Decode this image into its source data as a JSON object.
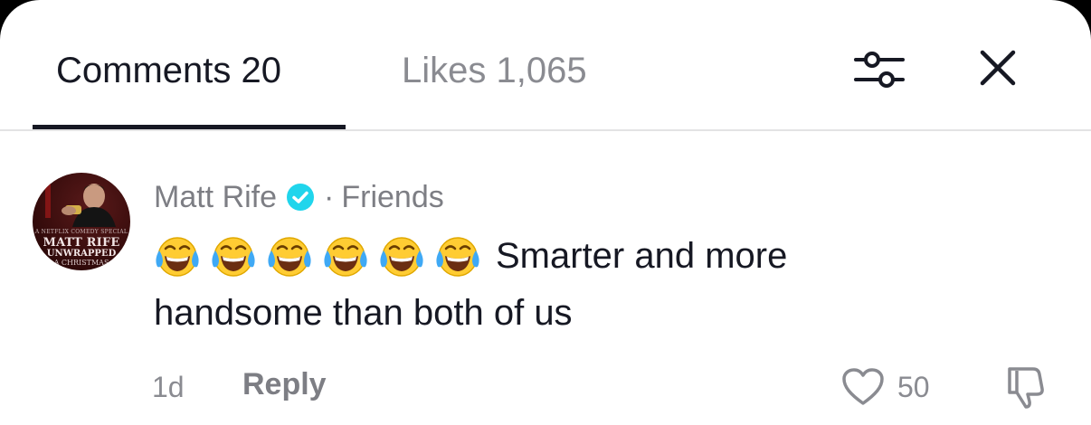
{
  "tabs": {
    "comments_label": "Comments 20",
    "likes_label": "Likes 1,065"
  },
  "icons": {
    "filter": "filter-sliders-icon",
    "close": "close-icon",
    "verified": "verified-badge-icon",
    "emoji": "face-with-tears-of-joy-emoji",
    "like": "heart-outline-icon",
    "dislike": "thumbs-down-outline-icon"
  },
  "comment": {
    "avatar_caption": {
      "tagline": "A NETFLIX COMEDY SPECIAL",
      "name": "MATT RIFE",
      "title": "UNWRAPPED",
      "subtitle": "A CHRISTMAS"
    },
    "author": "Matt Rife",
    "separator": "·",
    "relation": "Friends",
    "emoji_count": 6,
    "text_line1": "Smarter and more",
    "text_line2": "handsome than both of us",
    "time": "1d",
    "reply_label": "Reply",
    "like_count": "50"
  },
  "colors": {
    "primary_text": "#161823",
    "secondary_text": "#7d7e84",
    "verified_blue": "#20d5ec",
    "divider": "#e3e3e4"
  }
}
